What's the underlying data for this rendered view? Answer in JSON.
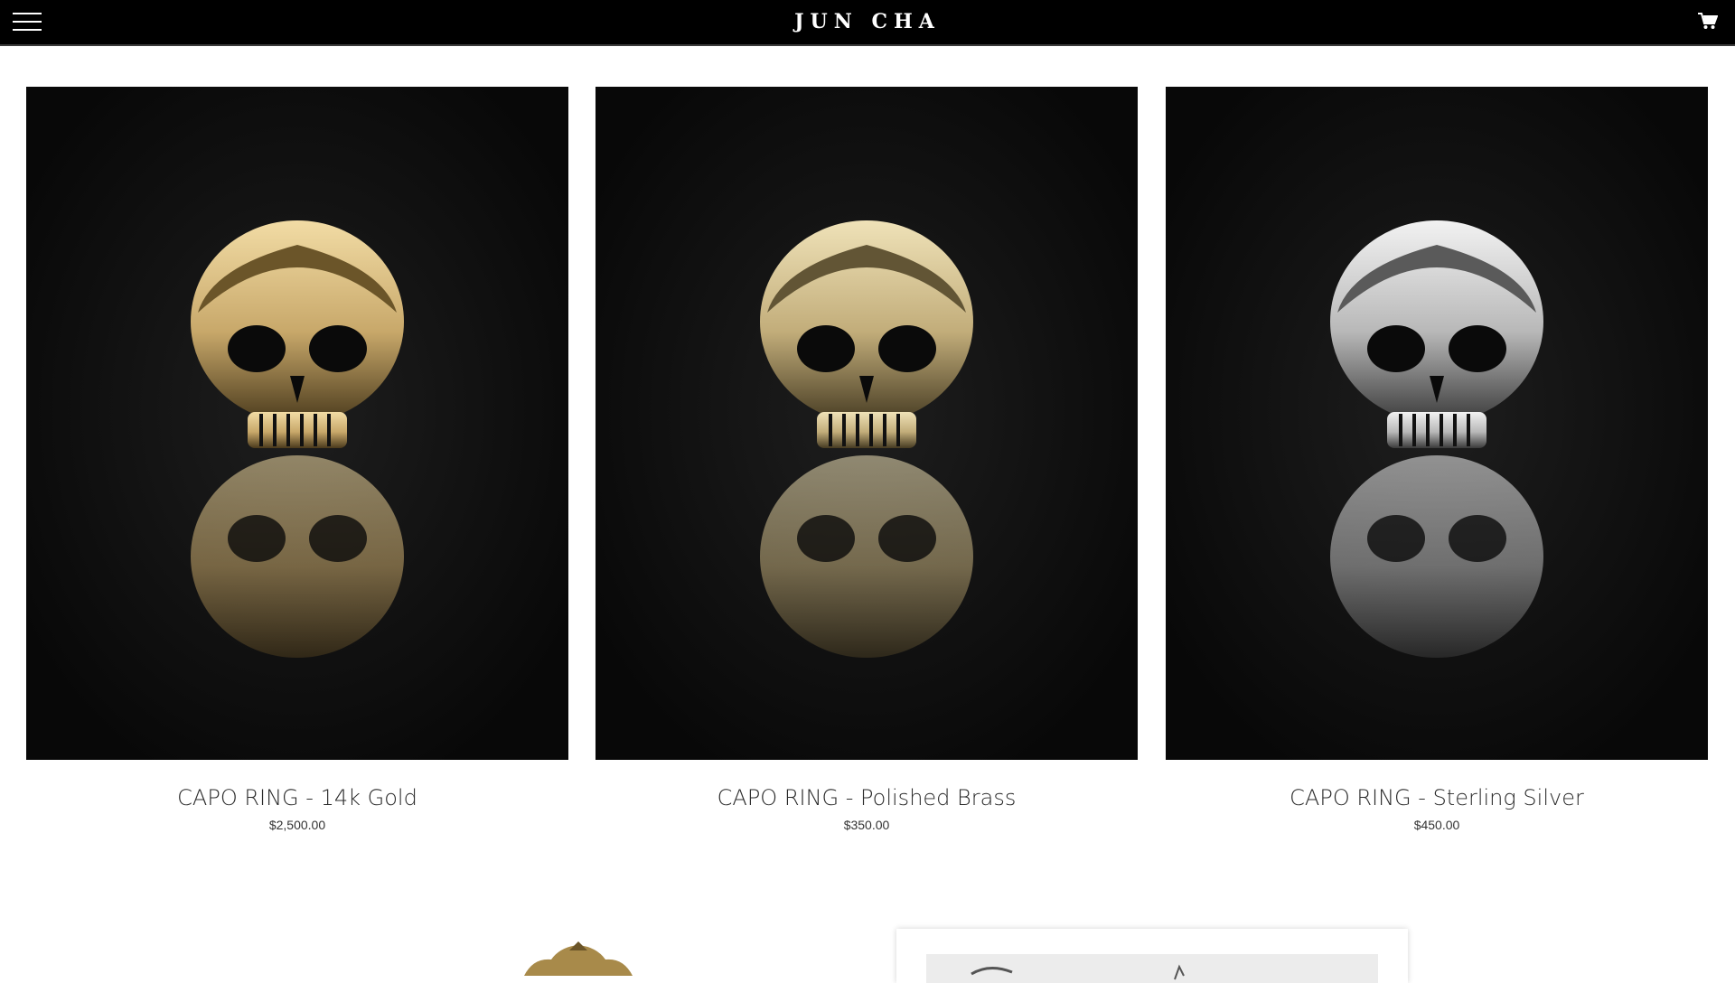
{
  "header": {
    "brand": "JUN CHA",
    "menu_icon": "hamburger-menu-icon",
    "cart_icon": "shopping-cart-icon",
    "background": "#000000"
  },
  "products": [
    {
      "name": "CAPO RING - 14k Gold",
      "price": "$2,500.00",
      "metal_color": "#c8a86a"
    },
    {
      "name": "CAPO RING - Polished Brass",
      "price": "$350.00",
      "metal_color": "#c2ad7a"
    },
    {
      "name": "CAPO RING - Sterling Silver",
      "price": "$450.00",
      "metal_color": "#b8b8b8"
    }
  ]
}
